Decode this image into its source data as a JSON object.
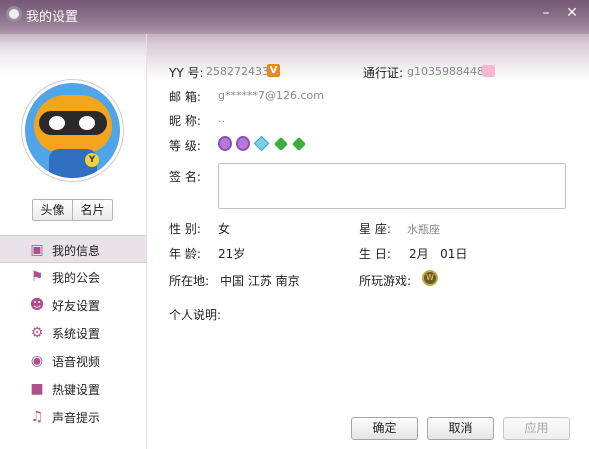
{
  "window": {
    "title": "我的设置",
    "minimize": "–",
    "close": "✕"
  },
  "avatar": {
    "badge": "Y"
  },
  "photo_buttons": [
    "头像",
    "名片"
  ],
  "nav": [
    {
      "label": "我的信息",
      "icon": "profile-card-icon",
      "active": true
    },
    {
      "label": "我的公会",
      "icon": "flag-icon",
      "active": false
    },
    {
      "label": "好友设置",
      "icon": "friend-settings-icon",
      "active": false
    },
    {
      "label": "系统设置",
      "icon": "gear-icon",
      "active": false
    },
    {
      "label": "语音视频",
      "icon": "camera-icon",
      "active": false
    },
    {
      "label": "热键设置",
      "icon": "hotkey-icon",
      "active": false
    },
    {
      "label": "声音提示",
      "icon": "music-note-icon",
      "active": false
    }
  ],
  "info": {
    "yy_label": "YY 号:",
    "yy_value": "258272433",
    "vip_badge": "V",
    "passport_label": "通行证:",
    "passport_value": "g1035988448",
    "email_label": "邮  箱:",
    "email_value": "g******7@126.com",
    "nickname_label": "昵  称:",
    "nickname_value": "..",
    "level_label": "等  级:",
    "signature_label": "签  名:",
    "gender_label": "性  别:",
    "gender_value": "女",
    "constellation_label": "星  座:",
    "constellation_value": "水瓶座",
    "age_label": "年  龄:",
    "age_value": "21岁",
    "birthday_label": "生  日:",
    "birthday_value": "2月   01日",
    "location_label": "所在地:",
    "location_value": "中国 江苏 南京",
    "games_label": "所玩游戏:",
    "game_badge": "W",
    "description_label": "个人说明:"
  },
  "buttons": {
    "ok": "确定",
    "cancel": "取消",
    "apply": "应用"
  }
}
